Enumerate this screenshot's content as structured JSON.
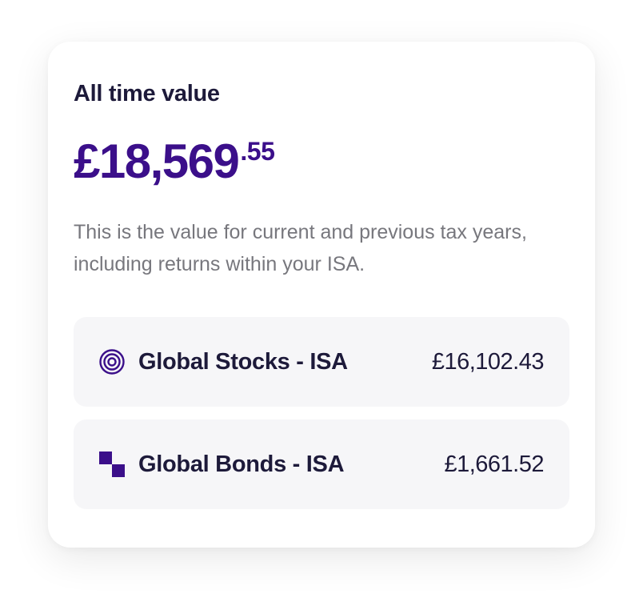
{
  "card": {
    "title": "All time value",
    "amount_main": "£18,569",
    "amount_pence": ".55",
    "description": "This is the value for current and previous tax years, including returns within your ISA."
  },
  "funds": [
    {
      "name": "Global Stocks - ISA",
      "value": "£16,102.43",
      "icon": "concentric-circles-icon"
    },
    {
      "name": "Global Bonds - ISA",
      "value": "£1,661.52",
      "icon": "checker-squares-icon"
    }
  ],
  "colors": {
    "brand_purple": "#3b0f8a",
    "text_dark": "#1d1a3a",
    "text_muted": "#77777d",
    "row_background": "#f6f6f8"
  }
}
